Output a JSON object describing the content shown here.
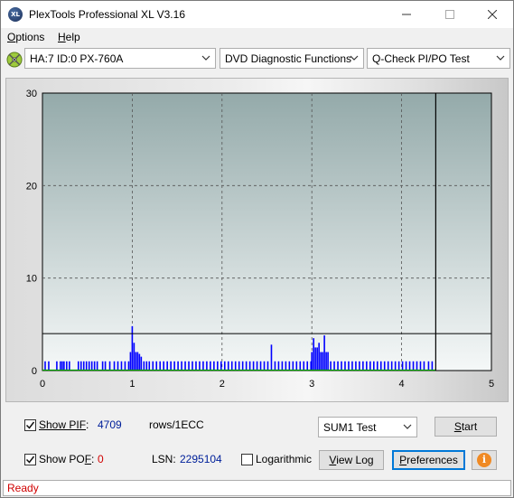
{
  "window": {
    "title": "PlexTools Professional XL V3.16",
    "app_icon_text": "XL",
    "controls": [
      "minimize-icon",
      "maximize-icon",
      "close-icon"
    ]
  },
  "menu": {
    "options": {
      "accel": "O",
      "rest": "ptions"
    },
    "help": {
      "accel": "H",
      "rest": "elp"
    }
  },
  "toolbar": {
    "drive": "HA:7 ID:0  PX-760A",
    "function": "DVD Diagnostic Functions",
    "test": "Q-Check PI/PO Test"
  },
  "chart_data": {
    "type": "bar",
    "xlabel": "",
    "ylabel": "",
    "xlim": [
      0,
      5
    ],
    "ylim": [
      0,
      30
    ],
    "x_ticks": [
      "0",
      "1",
      "2",
      "3",
      "4",
      "5"
    ],
    "y_ticks": [
      "0",
      "10",
      "20",
      "30"
    ],
    "grid": true,
    "threshold": 4,
    "progress_end": 4.38,
    "colors": {
      "bars": "#0000ff",
      "line": "#00a000",
      "plot_top": "#94aaaa",
      "plot_bottom": "#f5f8f8"
    },
    "series": [
      {
        "values": [
          [
            0.03,
            1
          ],
          [
            0.07,
            1
          ],
          [
            0.16,
            1
          ],
          [
            0.2,
            1
          ],
          [
            0.22,
            1
          ],
          [
            0.24,
            1
          ],
          [
            0.27,
            1
          ],
          [
            0.3,
            1
          ],
          [
            0.4,
            1
          ],
          [
            0.43,
            1
          ],
          [
            0.46,
            1
          ],
          [
            0.49,
            1
          ],
          [
            0.52,
            1
          ],
          [
            0.55,
            1
          ],
          [
            0.58,
            1
          ],
          [
            0.61,
            1
          ],
          [
            0.67,
            1
          ],
          [
            0.7,
            1
          ],
          [
            0.75,
            1
          ],
          [
            0.8,
            1
          ],
          [
            0.84,
            1
          ],
          [
            0.88,
            1
          ],
          [
            0.92,
            1
          ],
          [
            0.96,
            1
          ],
          [
            0.98,
            2
          ],
          [
            1.0,
            4.8
          ],
          [
            1.02,
            3
          ],
          [
            1.04,
            2
          ],
          [
            1.06,
            2
          ],
          [
            1.08,
            1.8
          ],
          [
            1.1,
            1.5
          ],
          [
            1.13,
            1
          ],
          [
            1.16,
            1
          ],
          [
            1.19,
            1
          ],
          [
            1.23,
            1
          ],
          [
            1.27,
            1
          ],
          [
            1.31,
            1
          ],
          [
            1.35,
            1
          ],
          [
            1.39,
            1
          ],
          [
            1.43,
            1
          ],
          [
            1.47,
            1
          ],
          [
            1.51,
            1
          ],
          [
            1.55,
            1
          ],
          [
            1.59,
            1
          ],
          [
            1.63,
            1
          ],
          [
            1.67,
            1
          ],
          [
            1.71,
            1
          ],
          [
            1.75,
            1
          ],
          [
            1.79,
            1
          ],
          [
            1.83,
            1
          ],
          [
            1.87,
            1
          ],
          [
            1.91,
            1
          ],
          [
            1.95,
            1
          ],
          [
            1.99,
            1
          ],
          [
            2.03,
            1
          ],
          [
            2.07,
            1
          ],
          [
            2.11,
            1
          ],
          [
            2.15,
            1
          ],
          [
            2.19,
            1
          ],
          [
            2.23,
            1
          ],
          [
            2.27,
            1
          ],
          [
            2.31,
            1
          ],
          [
            2.35,
            1
          ],
          [
            2.39,
            1
          ],
          [
            2.43,
            1
          ],
          [
            2.47,
            1
          ],
          [
            2.51,
            1
          ],
          [
            2.55,
            2.8
          ],
          [
            2.59,
            1
          ],
          [
            2.63,
            1
          ],
          [
            2.67,
            1
          ],
          [
            2.71,
            1
          ],
          [
            2.75,
            1
          ],
          [
            2.79,
            1
          ],
          [
            2.83,
            1
          ],
          [
            2.87,
            1
          ],
          [
            2.91,
            1
          ],
          [
            2.95,
            1
          ],
          [
            2.99,
            1
          ],
          [
            3.0,
            2
          ],
          [
            3.02,
            3.5
          ],
          [
            3.04,
            2.5
          ],
          [
            3.06,
            2.5
          ],
          [
            3.08,
            3
          ],
          [
            3.1,
            2
          ],
          [
            3.12,
            2
          ],
          [
            3.14,
            3.8
          ],
          [
            3.16,
            2
          ],
          [
            3.18,
            2
          ],
          [
            3.21,
            1
          ],
          [
            3.25,
            1
          ],
          [
            3.29,
            1
          ],
          [
            3.33,
            1
          ],
          [
            3.37,
            1
          ],
          [
            3.41,
            1
          ],
          [
            3.45,
            1
          ],
          [
            3.49,
            1
          ],
          [
            3.53,
            1
          ],
          [
            3.57,
            1
          ],
          [
            3.61,
            1
          ],
          [
            3.65,
            1
          ],
          [
            3.69,
            1
          ],
          [
            3.73,
            1
          ],
          [
            3.77,
            1
          ],
          [
            3.81,
            1
          ],
          [
            3.85,
            1
          ],
          [
            3.89,
            1
          ],
          [
            3.93,
            1
          ],
          [
            3.97,
            1
          ],
          [
            4.01,
            1
          ],
          [
            4.05,
            1
          ],
          [
            4.09,
            1
          ],
          [
            4.13,
            1
          ],
          [
            4.17,
            1
          ],
          [
            4.21,
            1
          ],
          [
            4.25,
            1
          ],
          [
            4.3,
            1
          ],
          [
            4.34,
            1
          ]
        ]
      }
    ]
  },
  "controls": {
    "show_pif_label": {
      "accel": "Show PIF",
      "rest": ":"
    },
    "pif_value": "4709",
    "rows_unit": "rows/1ECC",
    "show_pof_label": {
      "pre": "Show PO",
      "accel": "F",
      "rest": ":"
    },
    "pof_value": "0",
    "lsn_label": "LSN:",
    "lsn_value": "2295104",
    "logarithmic_label": "Logarithmic",
    "test_select": "SUM1 Test",
    "start_button": {
      "accel": "S",
      "rest": "tart"
    },
    "view_log_button": {
      "accel": "V",
      "rest": "iew Log"
    },
    "preferences_button": {
      "accel": "P",
      "rest": "references"
    },
    "info_glyph": "i",
    "pif_checked": true,
    "pof_checked": true,
    "logarithmic_checked": false
  },
  "status": {
    "text": "Ready"
  }
}
